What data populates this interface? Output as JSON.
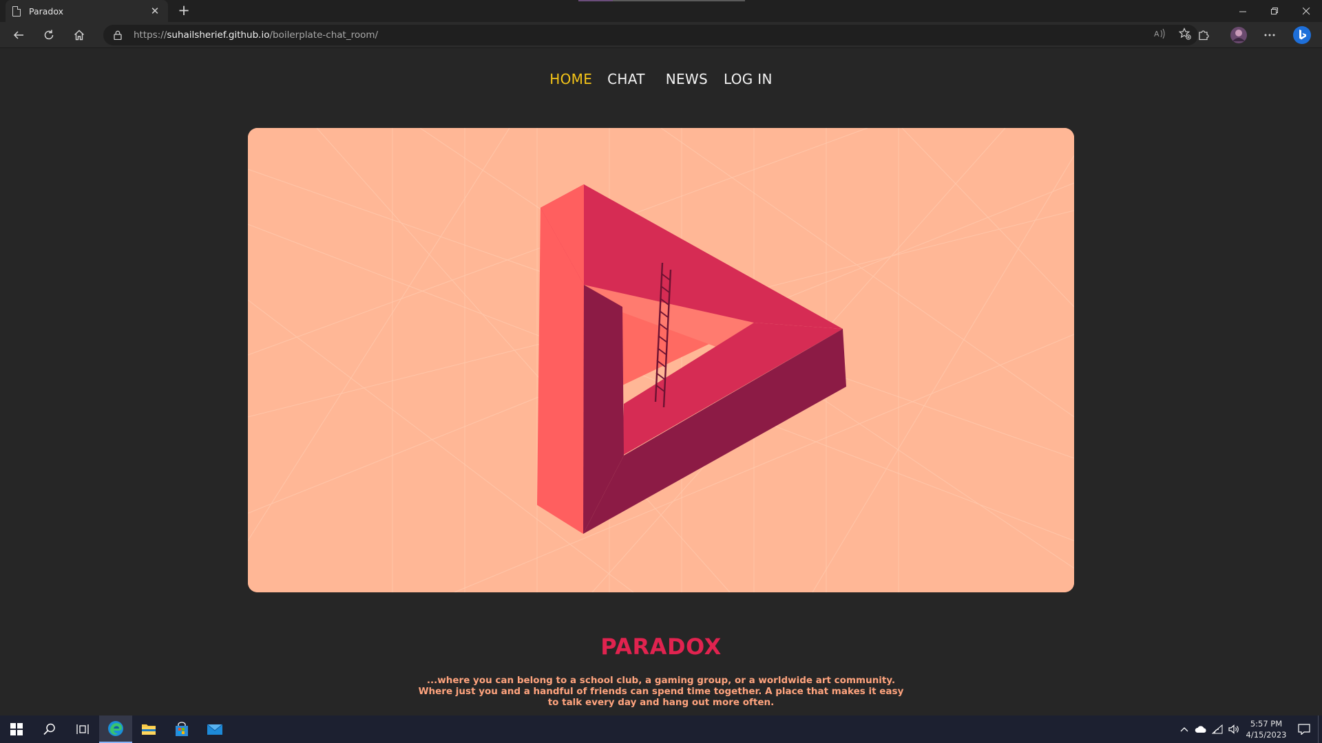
{
  "browser": {
    "tab_title": "Paradox",
    "url_prefix": "https://",
    "url_host": "suhailsherief.github.io",
    "url_path": "/boilerplate-chat_room/"
  },
  "nav": {
    "home": "HOME",
    "chat": "CHAT",
    "news": "NEWS",
    "login": "LOG IN"
  },
  "hero": {
    "illustration": "impossible-triangle-with-ladder",
    "colors": {
      "background": "#ffb796",
      "light_face": "#ff5f5f",
      "mid_face": "#d62c54",
      "dark_face": "#8c1b45",
      "ladder": "#6d1232"
    }
  },
  "content": {
    "title": "PARADOX",
    "tagline_line1": "...where you can belong to a school club, a gaming group, or a worldwide art community.",
    "tagline_line2": "Where just you and a handful of friends can spend time together. A place that makes it easy",
    "tagline_line3": "to talk every day and hang out more often."
  },
  "taskbar": {
    "time": "5:57 PM",
    "date": "4/15/2023"
  },
  "colors": {
    "nav_active": "#f5c518",
    "title": "#e0234f",
    "tagline": "#ffa47e",
    "page_bg": "#262626"
  }
}
